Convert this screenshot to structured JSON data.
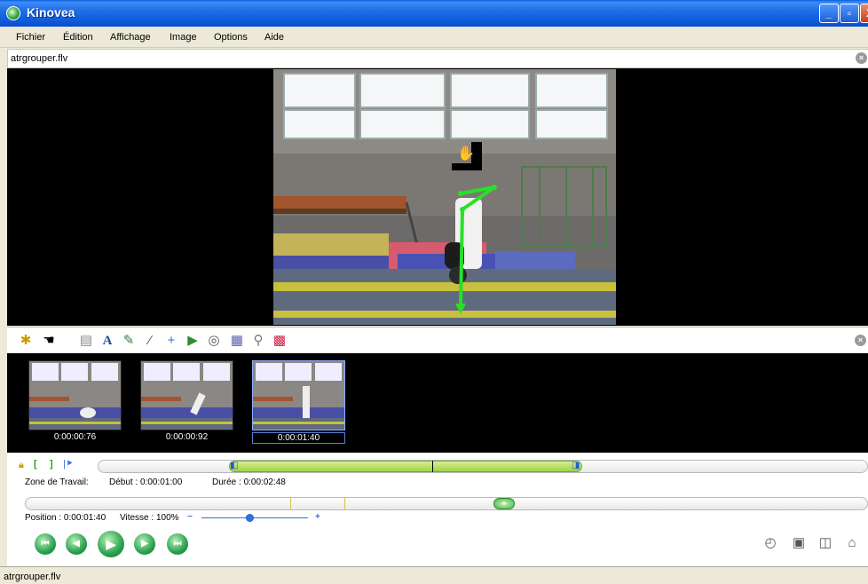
{
  "window": {
    "title": "Kinovea",
    "min_label": "_",
    "max_label": "▫",
    "close_label": "X"
  },
  "menu": {
    "items": [
      "Fichier",
      "Édition",
      "Affichage",
      "Image",
      "Options",
      "Aide"
    ]
  },
  "file": {
    "name": "atrgrouper.flv"
  },
  "thumbnails": [
    {
      "time": "0:00:00:76"
    },
    {
      "time": "0:00:00:92"
    },
    {
      "time": "0:00:01:40"
    }
  ],
  "workzone": {
    "label": "Zone de Travail:",
    "start": "Début : 0:00:01:00",
    "duration": "Durée : 0:00:02:48"
  },
  "playback": {
    "position": "Position : 0:00:01:40",
    "speed": "Vitesse : 100%",
    "speed_fraction": 0.45
  },
  "status": {
    "text": "atrgrouper.flv"
  },
  "colors": {
    "accent_green": "#2aa14f",
    "titlebar": "#1f6ee8"
  },
  "icons": [
    "new-key-image-icon",
    "hand-icon",
    "comment-icon",
    "text-icon",
    "pencil-icon",
    "line-icon",
    "cross-marker-icon",
    "angle-icon",
    "chrono-icon",
    "perspective-grid-icon",
    "magnifier-icon",
    "color-profile-icon"
  ]
}
